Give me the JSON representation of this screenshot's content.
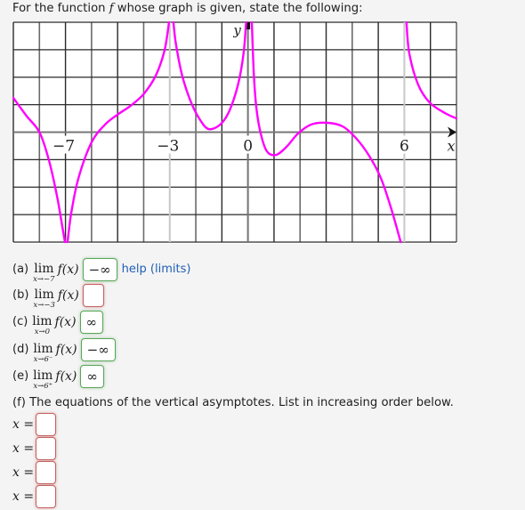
{
  "prompt": {
    "before": "For the function ",
    "fvar": "f",
    "after": " whose graph is given, state the following:"
  },
  "graph": {
    "xmin": -9,
    "xmax": 8,
    "ymin": -4,
    "ymax": 4,
    "x_tick_labels": [
      {
        "x": -7,
        "label": "−7"
      },
      {
        "x": -3,
        "label": "−3"
      },
      {
        "x": 0,
        "label": "0"
      },
      {
        "x": 6,
        "label": "6"
      }
    ],
    "x_axis_label": "x",
    "y_axis_label": "y",
    "curve_color": "#ff00ff",
    "asymptotes_drawn": [
      -3,
      6
    ],
    "curve_segments": [
      [
        [
          -9,
          1.25
        ],
        [
          -8.5,
          0.6
        ],
        [
          -8,
          0
        ],
        [
          -7.64,
          -1.0
        ],
        [
          -7.33,
          -2.3
        ],
        [
          -7.12,
          -3.45
        ],
        [
          -7.02,
          -4
        ]
      ],
      [
        [
          -6.92,
          -4
        ],
        [
          -6.78,
          -2.95
        ],
        [
          -6.5,
          -1.67
        ],
        [
          -6.0,
          -0.37
        ],
        [
          -5.48,
          0.28
        ],
        [
          -4.97,
          0.66
        ],
        [
          -4.46,
          0.99
        ],
        [
          -3.98,
          1.41
        ],
        [
          -3.54,
          2.05
        ],
        [
          -3.23,
          2.86
        ],
        [
          -3.1,
          3.5
        ],
        [
          -3.03,
          4
        ]
      ],
      [
        [
          -2.86,
          4
        ],
        [
          -2.76,
          3.19
        ],
        [
          -2.52,
          2.05
        ],
        [
          -2.18,
          1.08
        ],
        [
          -1.83,
          0.44
        ],
        [
          -1.5,
          0.11
        ],
        [
          -1.06,
          0.28
        ],
        [
          -0.72,
          0.76
        ],
        [
          -0.38,
          1.73
        ],
        [
          -0.17,
          2.86
        ],
        [
          -0.07,
          4
        ]
      ],
      [
        [
          0.15,
          4
        ],
        [
          0.22,
          2.22
        ],
        [
          0.32,
          0.92
        ],
        [
          0.49,
          -0.05
        ],
        [
          0.73,
          -0.7
        ],
        [
          1.07,
          -0.83
        ],
        [
          1.48,
          -0.53
        ],
        [
          1.92,
          -0.05
        ],
        [
          2.43,
          0.28
        ],
        [
          3.05,
          0.34
        ],
        [
          3.63,
          0.21
        ],
        [
          4.14,
          -0.21
        ],
        [
          4.65,
          -0.86
        ],
        [
          5.1,
          -1.67
        ],
        [
          5.5,
          -2.8
        ],
        [
          5.86,
          -4
        ]
      ],
      [
        [
          6.08,
          4
        ],
        [
          6.19,
          2.86
        ],
        [
          6.53,
          1.73
        ],
        [
          6.97,
          1.08
        ],
        [
          7.55,
          0.7
        ],
        [
          8,
          0.5
        ]
      ]
    ]
  },
  "questions": [
    {
      "label": "(a)",
      "lim": "lim",
      "approach": "x→−7",
      "expr_f": "f",
      "expr_arg": "(x)",
      "answer": "−∞",
      "status": "correct",
      "help": "help (limits)"
    },
    {
      "label": "(b)",
      "lim": "lim",
      "approach": "x→−3",
      "expr_f": "f",
      "expr_arg": "(x)",
      "answer": "",
      "status": "incorrect"
    },
    {
      "label": "(c)",
      "lim": "lim",
      "approach": "x→0",
      "expr_f": "f",
      "expr_arg": "(x)",
      "answer": "∞",
      "status": "correct"
    },
    {
      "label": "(d)",
      "lim": "lim",
      "approach": "x→6⁻",
      "expr_f": "f",
      "expr_arg": "(x)",
      "answer": "−∞",
      "status": "correct"
    },
    {
      "label": "(e)",
      "lim": "lim",
      "approach": "x→6⁺",
      "expr_f": "f",
      "expr_arg": "(x)",
      "answer": "∞",
      "status": "correct"
    }
  ],
  "part_f": {
    "text": "(f) The equations of the vertical asymptotes. List in increasing order below.",
    "var": "x",
    "eq": " =",
    "answers": [
      "",
      "",
      "",
      ""
    ]
  }
}
